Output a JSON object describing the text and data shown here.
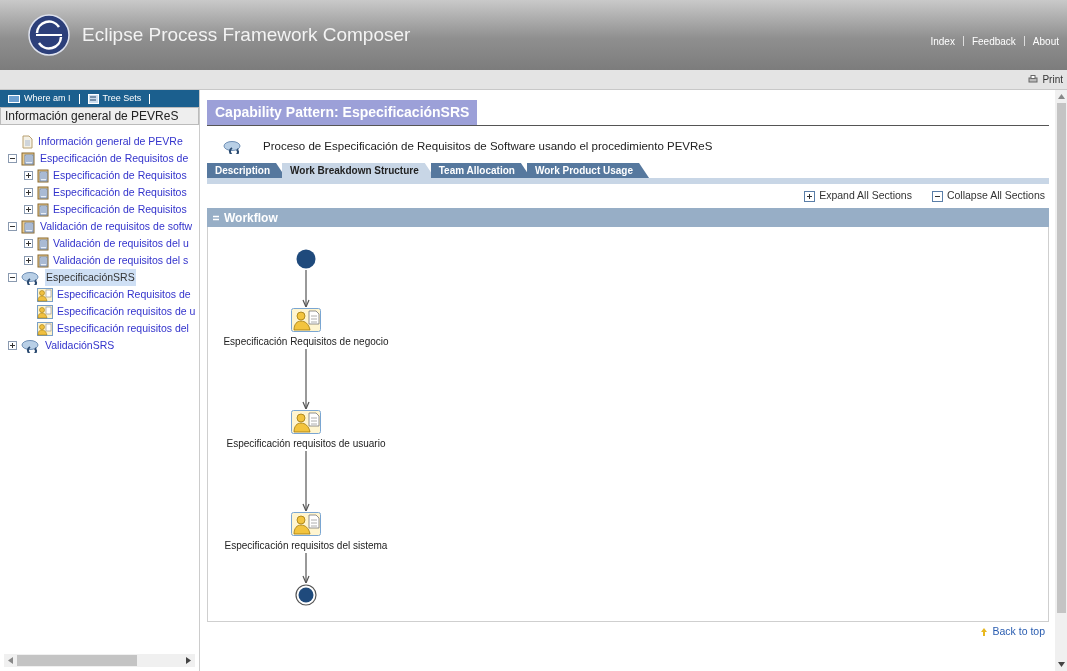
{
  "header": {
    "title": "Eclipse Process Framework Composer",
    "links": [
      "Index",
      "Feedback",
      "About"
    ]
  },
  "toolbar": {
    "print": "Print"
  },
  "nav": {
    "tabs": [
      "Where am I",
      "Tree Sets"
    ],
    "view_title": "Información general de PEVReS"
  },
  "tree": [
    {
      "label": "Información general de PEVRe",
      "kind": "page",
      "selected": false
    },
    {
      "label": "Especificación de Requisitos de",
      "kind": "book",
      "expanded": true,
      "selected": false,
      "children": [
        {
          "label": "Especificación de Requisitos",
          "kind": "doc",
          "expanded": false,
          "selected": false
        },
        {
          "label": "Especificación de Requisitos",
          "kind": "doc",
          "expanded": false,
          "selected": false
        },
        {
          "label": "Especificación de Requisitos",
          "kind": "doc",
          "expanded": false,
          "selected": false
        }
      ]
    },
    {
      "label": "Validación de requisitos de softw",
      "kind": "book",
      "expanded": true,
      "selected": false,
      "children": [
        {
          "label": "Validación de requisitos del u",
          "kind": "doc",
          "expanded": false,
          "selected": false
        },
        {
          "label": "Validación de requisitos del s",
          "kind": "doc",
          "expanded": false,
          "selected": false
        }
      ]
    },
    {
      "label": "EspecificaciónSRS",
      "kind": "pattern",
      "expanded": true,
      "selected": true,
      "children": [
        {
          "label": "Especificación Requisitos de",
          "kind": "task",
          "selected": false
        },
        {
          "label": "Especificación requisitos de u",
          "kind": "task",
          "selected": false
        },
        {
          "label": "Especificación requisitos del",
          "kind": "task",
          "selected": false
        }
      ]
    },
    {
      "label": "ValidaciónSRS",
      "kind": "pattern",
      "expanded": false,
      "selected": false
    }
  ],
  "content": {
    "heading": "Capability Pattern: EspecificaciónSRS",
    "description": "Proceso de Especificación de Requisitos de Software usando el procedimiento PEVReS",
    "tabs": [
      {
        "label": "Description",
        "selected": false
      },
      {
        "label": "Work Breakdown Structure",
        "selected": true
      },
      {
        "label": "Team Allocation",
        "selected": false
      },
      {
        "label": "Work Product Usage",
        "selected": false
      }
    ],
    "expand_all": "Expand All Sections",
    "collapse_all": "Collapse All Sections",
    "section": {
      "title": "Workflow",
      "expanded": true
    },
    "workflow": [
      {
        "kind": "start"
      },
      {
        "kind": "task",
        "label": "Especificación Requisitos de negocio"
      },
      {
        "kind": "task",
        "label": "Especificación requisitos de usuario"
      },
      {
        "kind": "task",
        "label": "Especificación requisitos del sistema"
      },
      {
        "kind": "end"
      }
    ],
    "back_to_top": "Back to top"
  }
}
